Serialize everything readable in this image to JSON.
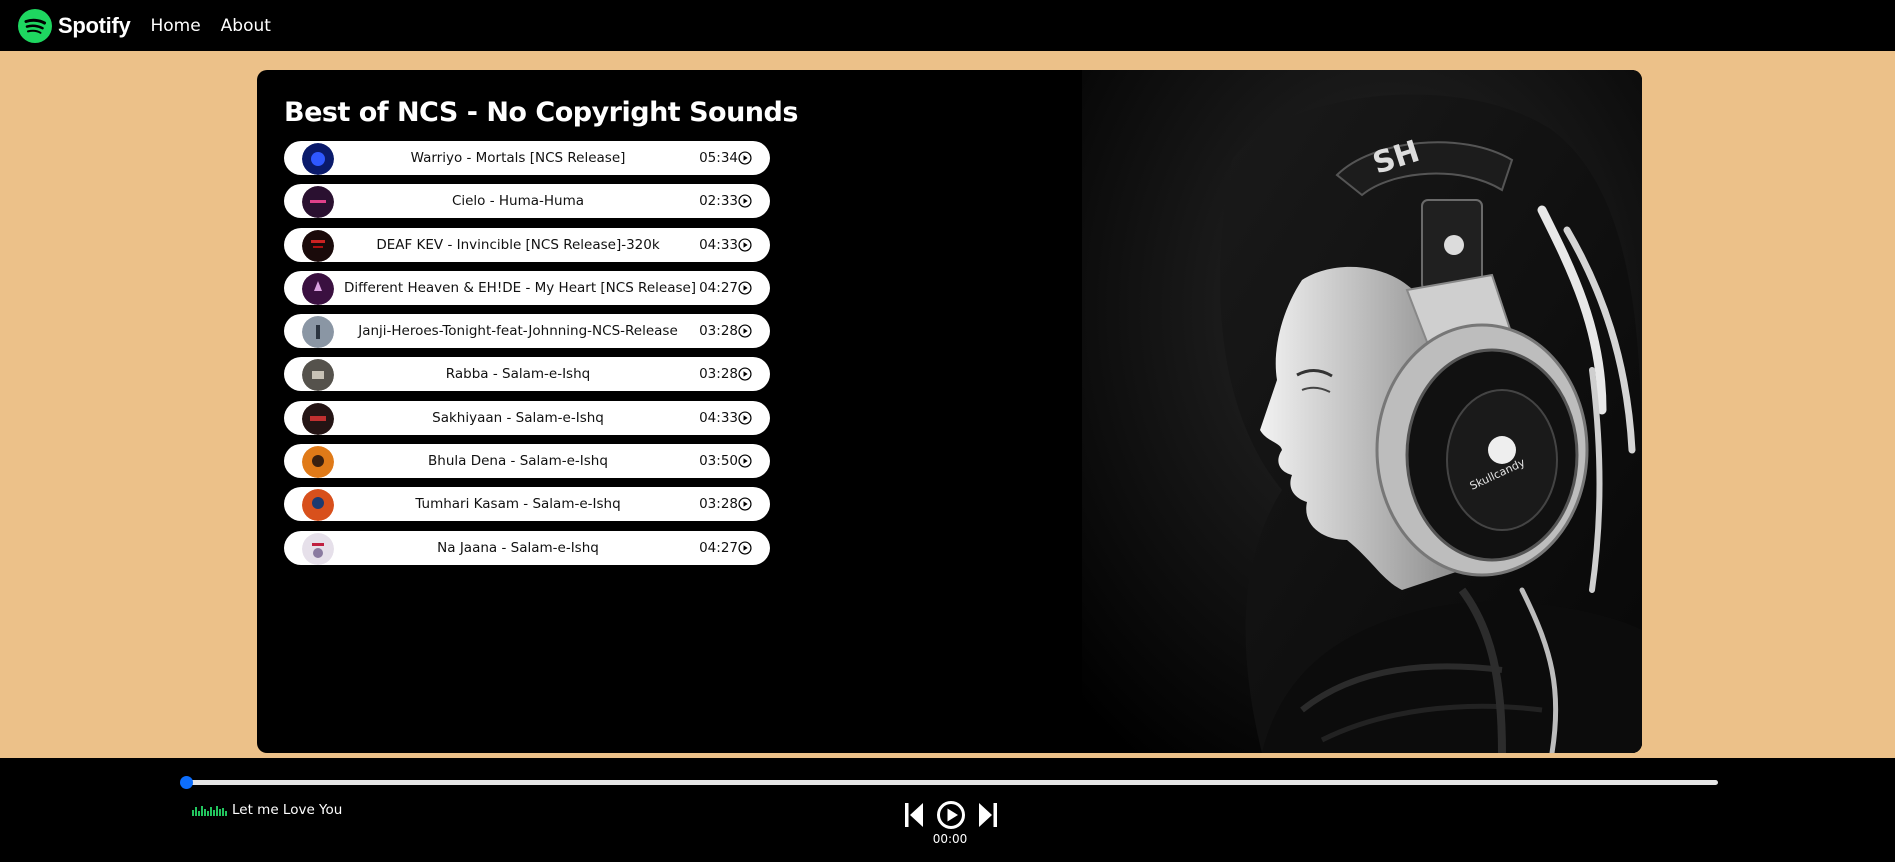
{
  "navbar": {
    "brand": "Spotify",
    "brand_icon": "spotify-logo-icon",
    "brand_color": "#1ed760",
    "links": [
      "Home",
      "About"
    ]
  },
  "playlist": {
    "title": "Best of NCS - No Copyright Sounds",
    "songs": [
      {
        "name": "Warriyo - Mortals [NCS Release]",
        "duration": "05:34"
      },
      {
        "name": "Cielo - Huma-Huma",
        "duration": "02:33"
      },
      {
        "name": "DEAF KEV - Invincible [NCS Release]-320k",
        "duration": "04:33"
      },
      {
        "name": "Different Heaven & EH!DE - My Heart [NCS Release]",
        "duration": "04:27"
      },
      {
        "name": "Janji-Heroes-Tonight-feat-Johnning-NCS-Release",
        "duration": "03:28"
      },
      {
        "name": "Rabba - Salam-e-Ishq",
        "duration": "03:28"
      },
      {
        "name": "Sakhiyaan - Salam-e-Ishq",
        "duration": "04:33"
      },
      {
        "name": "Bhula Dena - Salam-e-Ishq",
        "duration": "03:50"
      },
      {
        "name": "Tumhari Kasam - Salam-e-Ishq",
        "duration": "03:28"
      },
      {
        "name": "Na Jaana - Salam-e-Ishq",
        "duration": "04:27"
      }
    ]
  },
  "player": {
    "now_playing": "Let me Love You",
    "elapsed": "00:00",
    "progress": 0,
    "accent": "#0d6efd",
    "controls": [
      "previous-icon",
      "play-icon",
      "next-icon"
    ]
  },
  "colors": {
    "page_background": "#ecc189",
    "bars": "#000000"
  }
}
